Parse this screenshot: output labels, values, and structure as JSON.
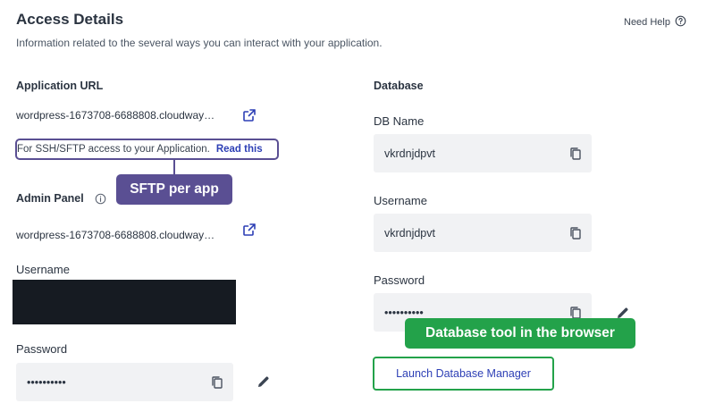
{
  "header": {
    "title": "Access Details",
    "subtitle": "Information related to the several ways you can interact with your application.",
    "help_label": "Need Help"
  },
  "app_url": {
    "label": "Application URL",
    "value": "wordpress-1673708-6688808.cloudway…",
    "ssh_text": "For SSH/SFTP access to your Application.",
    "ssh_link": "Read this",
    "callout": "SFTP per app"
  },
  "admin_panel": {
    "label": "Admin Panel",
    "url": "wordpress-1673708-6688808.cloudway…",
    "username_label": "Username",
    "password_label": "Password",
    "password_value": "••••••••••"
  },
  "database": {
    "label": "Database",
    "db_name_label": "DB Name",
    "db_name_value": "vkrdnjdpvt",
    "username_label": "Username",
    "username_value": "vkrdnjdpvt",
    "password_label": "Password",
    "password_value": "••••••••••",
    "callout": "Database tool in the browser",
    "launch_label": "Launch Database Manager"
  },
  "colors": {
    "callout_purple": "#5a4f93",
    "callout_green": "#23a24a",
    "link_blue": "#2d3fb5",
    "input_bg": "#f1f2f4"
  },
  "icons": {
    "help": "help-circle-icon",
    "external": "external-link-icon",
    "info": "info-icon",
    "copy": "copy-icon",
    "edit": "pencil-icon"
  }
}
